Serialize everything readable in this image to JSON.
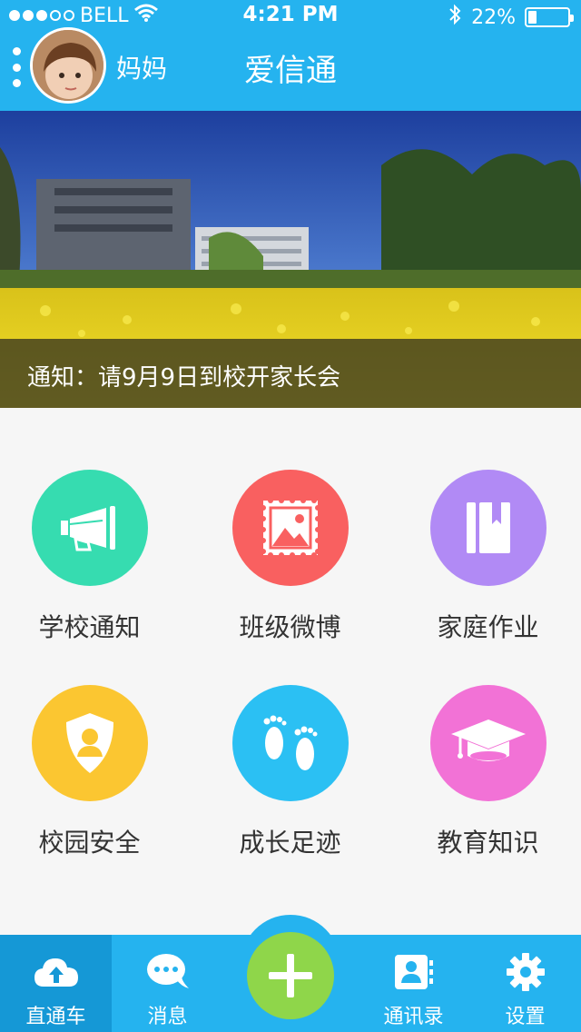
{
  "status_bar": {
    "carrier": "BELL",
    "time": "4:21 PM",
    "battery": "22%",
    "battery_level": 0.22,
    "signal_bars_filled": 3,
    "signal_bars_total": 5
  },
  "header": {
    "user_name": "妈妈",
    "title": "爱信通",
    "background_color": "#25b3ef"
  },
  "banner": {
    "notice": "通知：请9月9日到校开家长会"
  },
  "features": [
    {
      "label": "学校通知",
      "icon": "megaphone-icon",
      "color": "#36dcb0"
    },
    {
      "label": "班级微博",
      "icon": "picture-stamp-icon",
      "color": "#f96060"
    },
    {
      "label": "家庭作业",
      "icon": "book-icon",
      "color": "#b18af5"
    },
    {
      "label": "校园安全",
      "icon": "shield-person-icon",
      "color": "#fbc631"
    },
    {
      "label": "成长足迹",
      "icon": "footprints-icon",
      "color": "#2bc0f3"
    },
    {
      "label": "教育知识",
      "icon": "graduation-cap-icon",
      "color": "#f272d6"
    }
  ],
  "tabbar": {
    "tabs": [
      {
        "label": "直通车",
        "icon": "cloud-upload-icon",
        "active": true
      },
      {
        "label": "消息",
        "icon": "chat-bubble-icon",
        "active": false
      },
      {
        "label": "通讯录",
        "icon": "contacts-book-icon",
        "active": false
      },
      {
        "label": "设置",
        "icon": "gear-icon",
        "active": false
      }
    ],
    "center_button_icon": "plus-icon",
    "center_button_color": "#8fd64a"
  }
}
